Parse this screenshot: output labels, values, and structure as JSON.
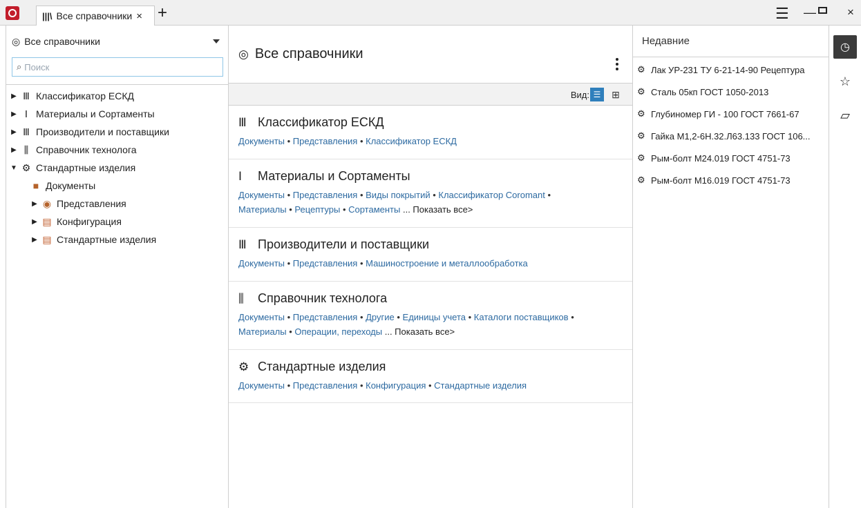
{
  "titlebar": {
    "tab_label": "Все справочники",
    "tab_close": "×",
    "add_tab": "+",
    "menu": "☰",
    "minimize": "—",
    "close": "×"
  },
  "left": {
    "header": "Все справочники",
    "search_placeholder": "Поиск",
    "tree": [
      {
        "label": "Классификатор ЕСКД",
        "icon": "books-icon",
        "expanded": false
      },
      {
        "label": "Материалы и Сортаменты",
        "icon": "beam-icon",
        "expanded": false
      },
      {
        "label": "Производители и поставщики",
        "icon": "books-icon",
        "expanded": false
      },
      {
        "label": "Справочник технолога",
        "icon": "library-icon",
        "expanded": false
      },
      {
        "label": "Стандартные изделия",
        "icon": "bolt-icon",
        "expanded": true
      },
      {
        "label": "Документы",
        "icon": "document-icon"
      },
      {
        "label": "Представления",
        "icon": "view-icon"
      },
      {
        "label": "Конфигурация",
        "icon": "config-icon"
      },
      {
        "label": "Стандартные изделия",
        "icon": "config-icon"
      }
    ]
  },
  "center": {
    "title": "Все справочники",
    "view_label": "Вид:",
    "cards": [
      {
        "title": "Классификатор ЕСКД",
        "links_line1": [
          "Документы",
          "Представления",
          "Классификатор ЕСКД"
        ]
      },
      {
        "title": "Материалы и Сортаменты",
        "links_line1": [
          "Документы",
          "Представления",
          "Виды покрытий",
          "Классификатор Coromant"
        ],
        "links_line2": [
          "Материалы",
          "Рецептуры",
          "Сортаменты"
        ],
        "more": "... Показать все>"
      },
      {
        "title": "Производители и поставщики",
        "links_line1": [
          "Документы",
          "Представления",
          "Машиностроение и металлообработка"
        ]
      },
      {
        "title": "Справочник технолога",
        "links_line1": [
          "Документы",
          "Представления",
          "Другие",
          "Единицы учета",
          "Каталоги поставщиков"
        ],
        "links_line2": [
          "Материалы",
          "Операции, переходы"
        ],
        "more": "... Показать все>"
      },
      {
        "title": "Стандартные изделия",
        "links_line1": [
          "Документы",
          "Представления",
          "Конфигурация",
          "Стандартные изделия"
        ]
      }
    ]
  },
  "recent": {
    "header": "Недавние",
    "items": [
      "Лак УР-231 ТУ 6-21-14-90 Рецептура",
      "Сталь 05кп ГОСТ 1050-2013",
      "Глубиномер ГИ - 100 ГОСТ 7661-67",
      "Гайка М1,2-6Н.32.Л63.133 ГОСТ 106...",
      "Рым-болт М24.019 ГОСТ 4751-73",
      "Рым-болт М16.019 ГОСТ 4751-73"
    ]
  }
}
